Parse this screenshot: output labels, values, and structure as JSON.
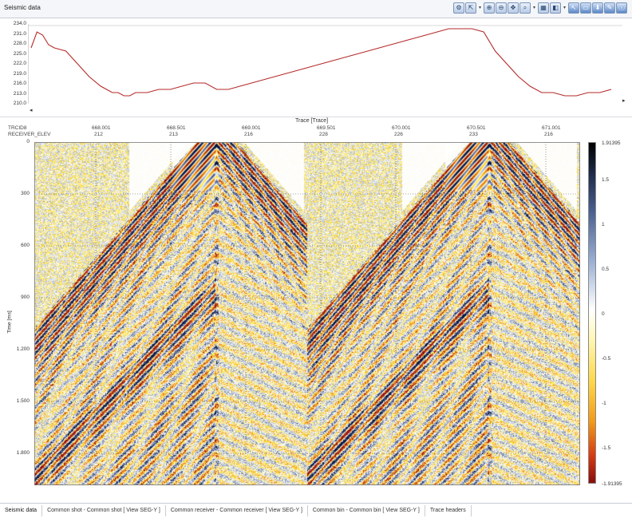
{
  "window": {
    "title": "Seismic data"
  },
  "toolbar": {
    "buttons": [
      {
        "name": "settings-icon",
        "glyph": "⚙",
        "dropdown": false
      },
      {
        "name": "export-icon",
        "glyph": "⇱",
        "dropdown": true
      },
      {
        "name": "zoom-in-icon",
        "glyph": "⊕",
        "dropdown": false
      },
      {
        "name": "zoom-out-icon",
        "glyph": "⊖",
        "dropdown": false
      },
      {
        "name": "pan-icon",
        "glyph": "✥",
        "dropdown": false
      },
      {
        "name": "zoom-extent-icon",
        "glyph": "⌕",
        "dropdown": true
      },
      {
        "name": "grid-icon",
        "glyph": "▦",
        "dropdown": false
      },
      {
        "name": "color-scale-icon",
        "glyph": "◧",
        "dropdown": true
      },
      {
        "name": "pointer-icon",
        "glyph": "↖",
        "dropdown": false
      },
      {
        "name": "window-icon",
        "glyph": "▭",
        "dropdown": false
      },
      {
        "name": "save-icon",
        "glyph": "⬇",
        "dropdown": false
      },
      {
        "name": "pencil-icon",
        "glyph": "✎",
        "dropdown": false
      },
      {
        "name": "info-icon",
        "glyph": "ⓘ",
        "dropdown": false
      }
    ]
  },
  "elevation_panel": {
    "y_ticks": [
      "234.0",
      "231.0",
      "228.0",
      "225.0",
      "222.0",
      "219.0",
      "216.0",
      "213.0",
      "210.0"
    ],
    "x_axis_label": "Trace [Trace]",
    "left_arrow": "◂",
    "right_arrow": "▸",
    "line_color": "#b52a2a"
  },
  "seismic_panel": {
    "header_rows": [
      "TRCID8",
      "RECEIVER_ELEV"
    ],
    "trace_ticks": [
      {
        "label": "668.001",
        "elev": "212"
      },
      {
        "label": "668.501",
        "elev": "213"
      },
      {
        "label": "669.001",
        "elev": "216"
      },
      {
        "label": "669.501",
        "elev": "228"
      },
      {
        "label": "670.001",
        "elev": "226"
      },
      {
        "label": "670.501",
        "elev": "233"
      },
      {
        "label": "671.001",
        "elev": "216"
      }
    ],
    "y_axis_label": "Time [ms]",
    "time_ticks": [
      "0",
      "300",
      "600",
      "900",
      "1.200",
      "1.500",
      "1.800"
    ]
  },
  "colorbar": {
    "max": "1.91395",
    "min": "-1.91395",
    "ticks": [
      "1.5",
      "1",
      "0.5",
      "0",
      "-0.5",
      "-1",
      "-1.5"
    ]
  },
  "tabs": [
    "Seismic data",
    "Common shot - Common shot [ View SEG-Y ]",
    "Common receiver - Common receiver [ View SEG-Y ]",
    "Common bin - Common bin [ View SEG-Y ]",
    "Trace headers"
  ],
  "chart_data": [
    {
      "type": "line",
      "title": "",
      "xlabel": "Trace [Trace]",
      "ylabel": "",
      "ylim": [
        210,
        234
      ],
      "x": [
        0,
        2,
        4,
        6,
        8,
        12,
        16,
        20,
        24,
        28,
        30,
        32,
        34,
        36,
        40,
        44,
        48,
        52,
        56,
        60,
        64,
        68,
        72,
        76,
        80,
        84,
        88,
        92,
        96,
        100,
        104,
        108,
        112,
        116,
        120,
        124,
        128,
        132,
        136,
        140,
        144,
        148,
        152,
        156,
        160,
        164,
        168,
        172,
        176,
        180,
        184,
        188,
        192,
        196,
        200
      ],
      "series": [
        {
          "values": [
            227,
            232,
            231,
            228,
            227,
            226,
            222,
            218,
            215,
            213,
            213,
            212,
            212,
            213,
            213,
            214,
            214,
            215,
            216,
            216,
            214,
            214,
            215,
            216,
            217,
            218,
            219,
            220,
            221,
            222,
            223,
            224,
            225,
            226,
            227,
            228,
            229,
            230,
            231,
            232,
            233,
            233,
            233,
            232,
            226,
            222,
            218,
            215,
            213,
            213,
            212,
            212,
            213,
            213,
            214
          ]
        }
      ]
    },
    {
      "type": "heatmap",
      "title": "",
      "xlabel": "",
      "ylabel": "Time [ms]",
      "x_ticks": [
        "668.001",
        "668.501",
        "669.001",
        "669.501",
        "670.001",
        "670.501",
        "671.001"
      ],
      "y_ticks": [
        "0",
        "300",
        "600",
        "900",
        "1.200",
        "1.500",
        "1.800"
      ],
      "color_range": [
        -1.91395,
        1.91395
      ]
    }
  ]
}
